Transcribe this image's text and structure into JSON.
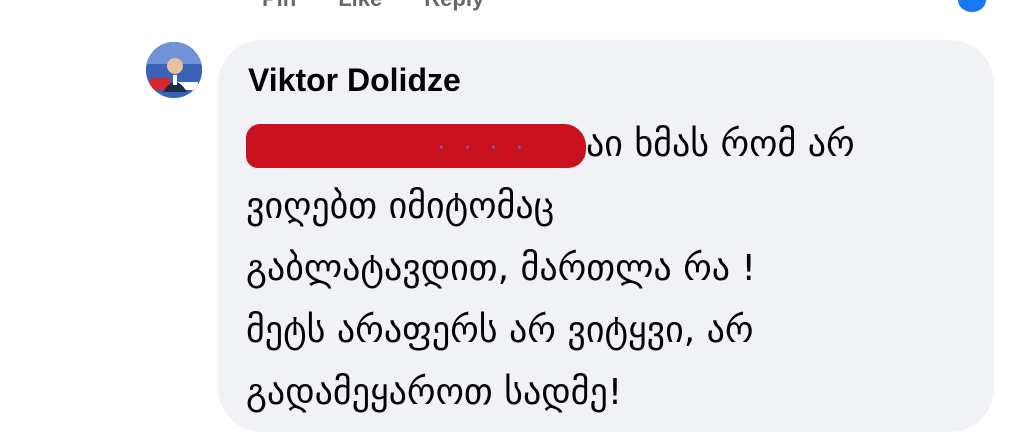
{
  "previous_comment": {
    "actions": [
      "Pin",
      "Like",
      "Reply"
    ]
  },
  "comment": {
    "author": "Viktor Dolidze",
    "lines": [
      "აი ხმას რომ არ",
      "ვიღებთ იმიტომაც",
      "გაბლატავდით, მართლა რა !",
      "მეტს არაფერს არ ვიტყვი, არ",
      "გადამეყაროთ სადმე!"
    ]
  },
  "colors": {
    "bubble": "#f0f2f5",
    "author_text": "#050505",
    "redaction": "#c8101e",
    "link_blue": "#1877f2"
  }
}
